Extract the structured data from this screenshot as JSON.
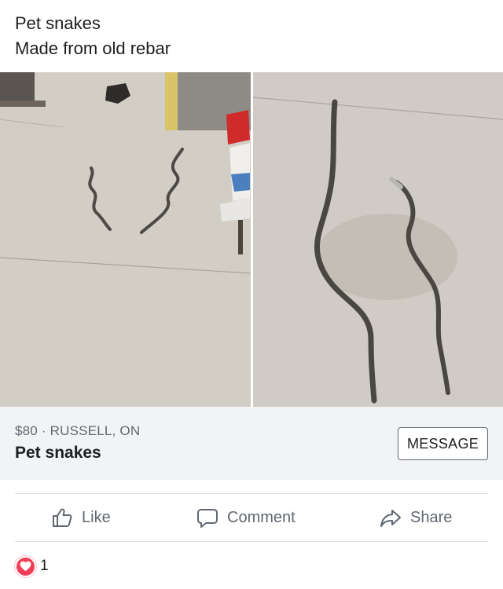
{
  "post": {
    "line1": "Pet snakes",
    "line2": "Made from old rebar"
  },
  "listing": {
    "price": "$80",
    "separator": "·",
    "location": "RUSSELL, ON",
    "meta": "$80 · RUSSELL, ON",
    "title": "Pet snakes",
    "message_label": "MESSAGE"
  },
  "actions": {
    "like_label": "Like",
    "comment_label": "Comment",
    "share_label": "Share"
  },
  "reactions": {
    "count": "1",
    "icon": "heart-icon"
  },
  "colors": {
    "reaction_heart": "#f33e58",
    "meta_text": "#606770",
    "listing_bg": "#f2f3f5"
  }
}
